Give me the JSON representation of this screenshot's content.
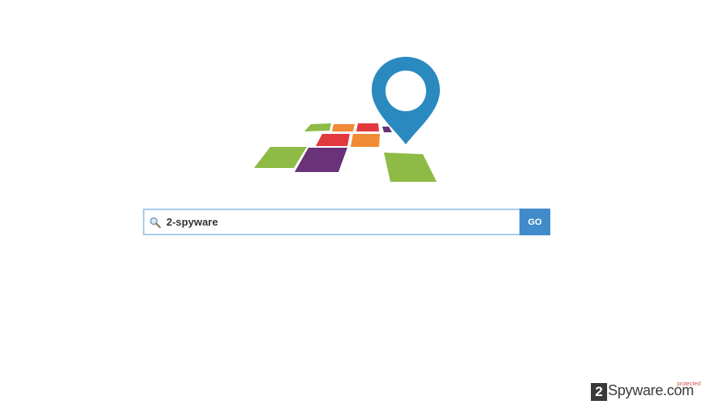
{
  "search": {
    "value": "2-spyware",
    "icon": "magnifier-icon",
    "go_label": "GO"
  },
  "logo": {
    "name": "map-pin-logo",
    "colors": {
      "pin": "#2a8ac0",
      "green": "#8dbb45",
      "purple": "#6a3278",
      "red": "#e2393f",
      "orange": "#f18a35"
    }
  },
  "watermark": {
    "mark": "2",
    "brand": "Spyware.com",
    "sub": "protected"
  },
  "colors": {
    "accent": "#428bca",
    "input_border": "#a9cdea"
  }
}
